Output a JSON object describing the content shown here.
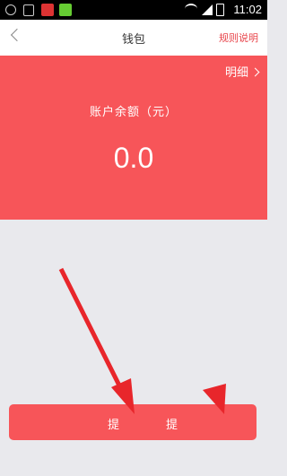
{
  "status_bar": {
    "time": "11:02"
  },
  "nav": {
    "title": "钱包",
    "right_link": "规则说明"
  },
  "balance": {
    "detail_label": "明细",
    "label": "账户余额（元）",
    "value": "0.0"
  },
  "actions": {
    "left_label": "提",
    "right_label": "提"
  },
  "colors": {
    "accent": "#f75559",
    "link": "#e8454b",
    "background": "#e9e9ed"
  }
}
